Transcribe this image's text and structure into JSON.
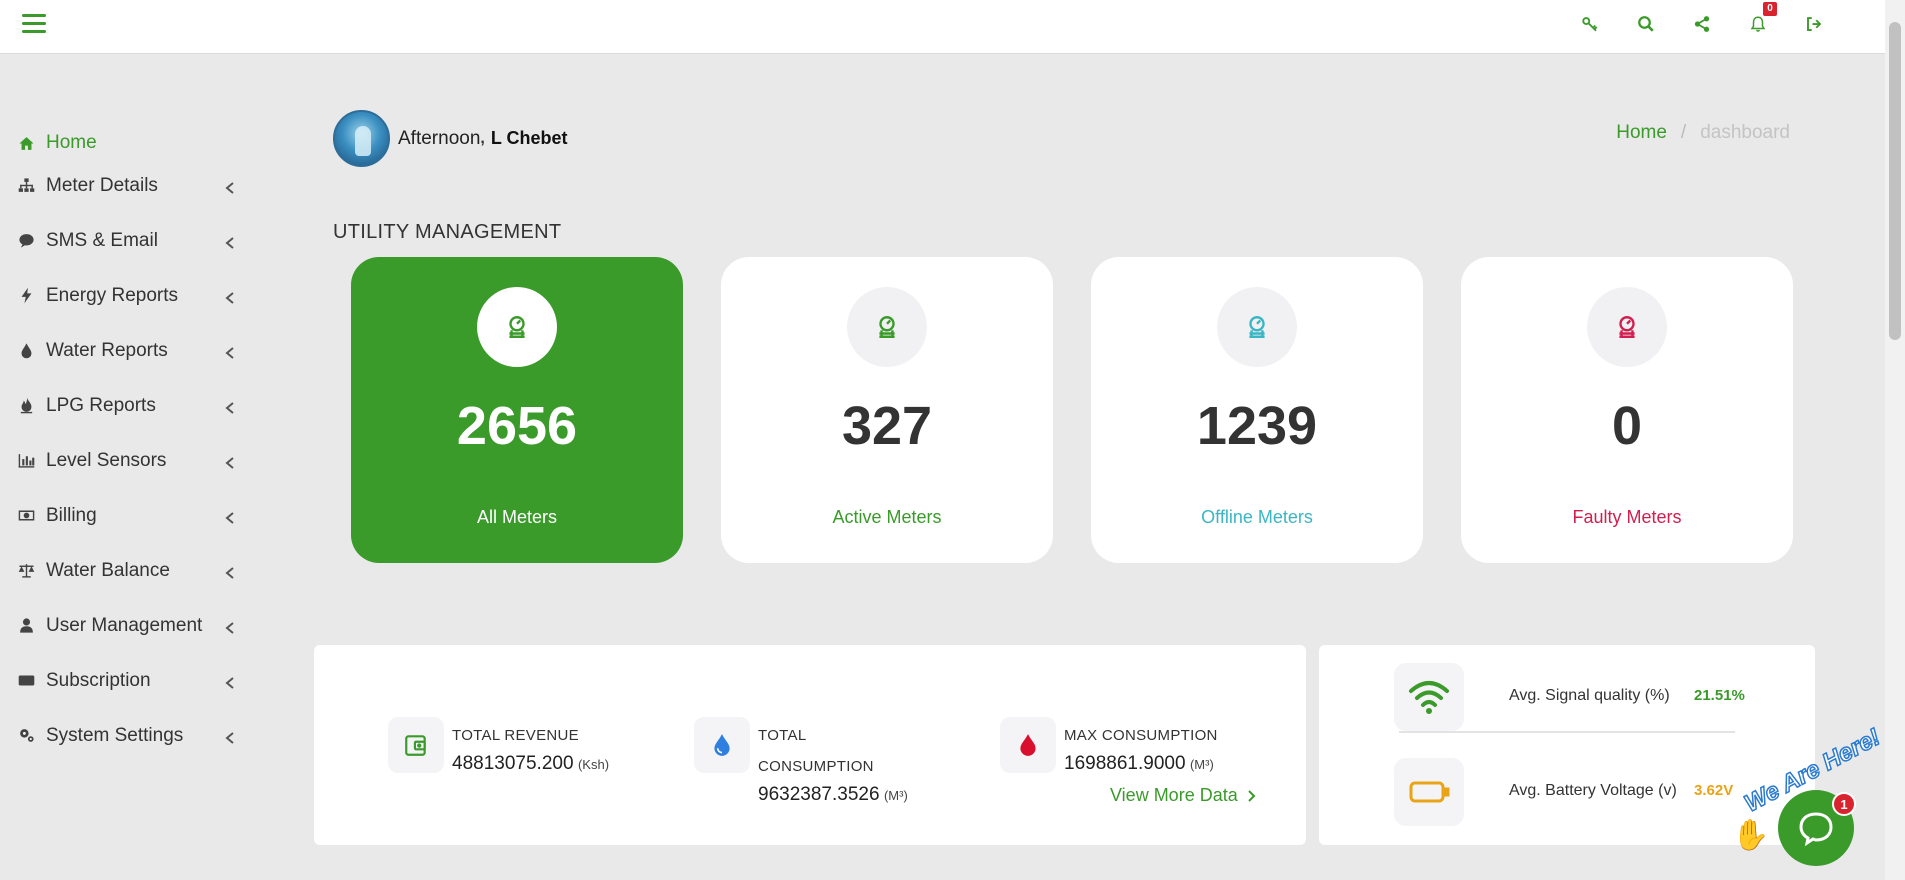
{
  "colors": {
    "brand": "#3a9a2a",
    "active": "#3a9a2a",
    "offline": "#3bb6c4",
    "faulty": "#d21f4f",
    "battery": "#e8a416"
  },
  "topbar": {
    "notification_count": "0",
    "icons": [
      "key-icon",
      "search-icon",
      "share-icon",
      "bell-icon",
      "sign-out-icon"
    ]
  },
  "sidebar": {
    "items": [
      {
        "label": "Home",
        "icon": "home-icon"
      },
      {
        "label": "Meter Details",
        "icon": "sitemap-icon"
      },
      {
        "label": "SMS & Email",
        "icon": "comment-icon"
      },
      {
        "label": "Energy Reports",
        "icon": "bolt-icon"
      },
      {
        "label": "Water Reports",
        "icon": "drop-icon"
      },
      {
        "label": "LPG Reports",
        "icon": "fire-icon"
      },
      {
        "label": "Level Sensors",
        "icon": "bar-chart-icon"
      },
      {
        "label": "Billing",
        "icon": "money-icon"
      },
      {
        "label": "Water Balance",
        "icon": "balance-scale-icon"
      },
      {
        "label": "User Management",
        "icon": "user-icon"
      },
      {
        "label": "Subscription",
        "icon": "card-icon"
      },
      {
        "label": "System Settings",
        "icon": "cogs-icon"
      }
    ]
  },
  "greeting": {
    "salutation": "Afternoon",
    "comma": ",",
    "name": "L Chebet"
  },
  "breadcrumb": {
    "home": "Home",
    "separator": "/",
    "current": "dashboard"
  },
  "section_title": "UTILITY MANAGEMENT",
  "cards": [
    {
      "value": "2656",
      "label": "All Meters"
    },
    {
      "value": "327",
      "label": "Active Meters"
    },
    {
      "value": "1239",
      "label": "Offline Meters"
    },
    {
      "value": "0",
      "label": "Faulty Meters"
    }
  ],
  "totals": {
    "revenue": {
      "label": "TOTAL REVENUE",
      "value": "48813075.200",
      "unit": "(Ksh)"
    },
    "consumption": {
      "label_line1": "TOTAL",
      "label_line2": "CONSUMPTION",
      "value": "9632387.3526",
      "unit": "(M³)"
    },
    "max": {
      "label": "MAX CONSUMPTION",
      "value": "1698861.9000",
      "unit": "(M³)"
    },
    "view_more": "View More Data"
  },
  "signal": {
    "quality": {
      "label": "Avg. Signal quality (%)",
      "value": "21.51%"
    },
    "battery": {
      "label": "Avg. Battery Voltage (v)",
      "value": "3.62V"
    }
  },
  "chat": {
    "text": "We Are Here!",
    "badge": "1"
  }
}
